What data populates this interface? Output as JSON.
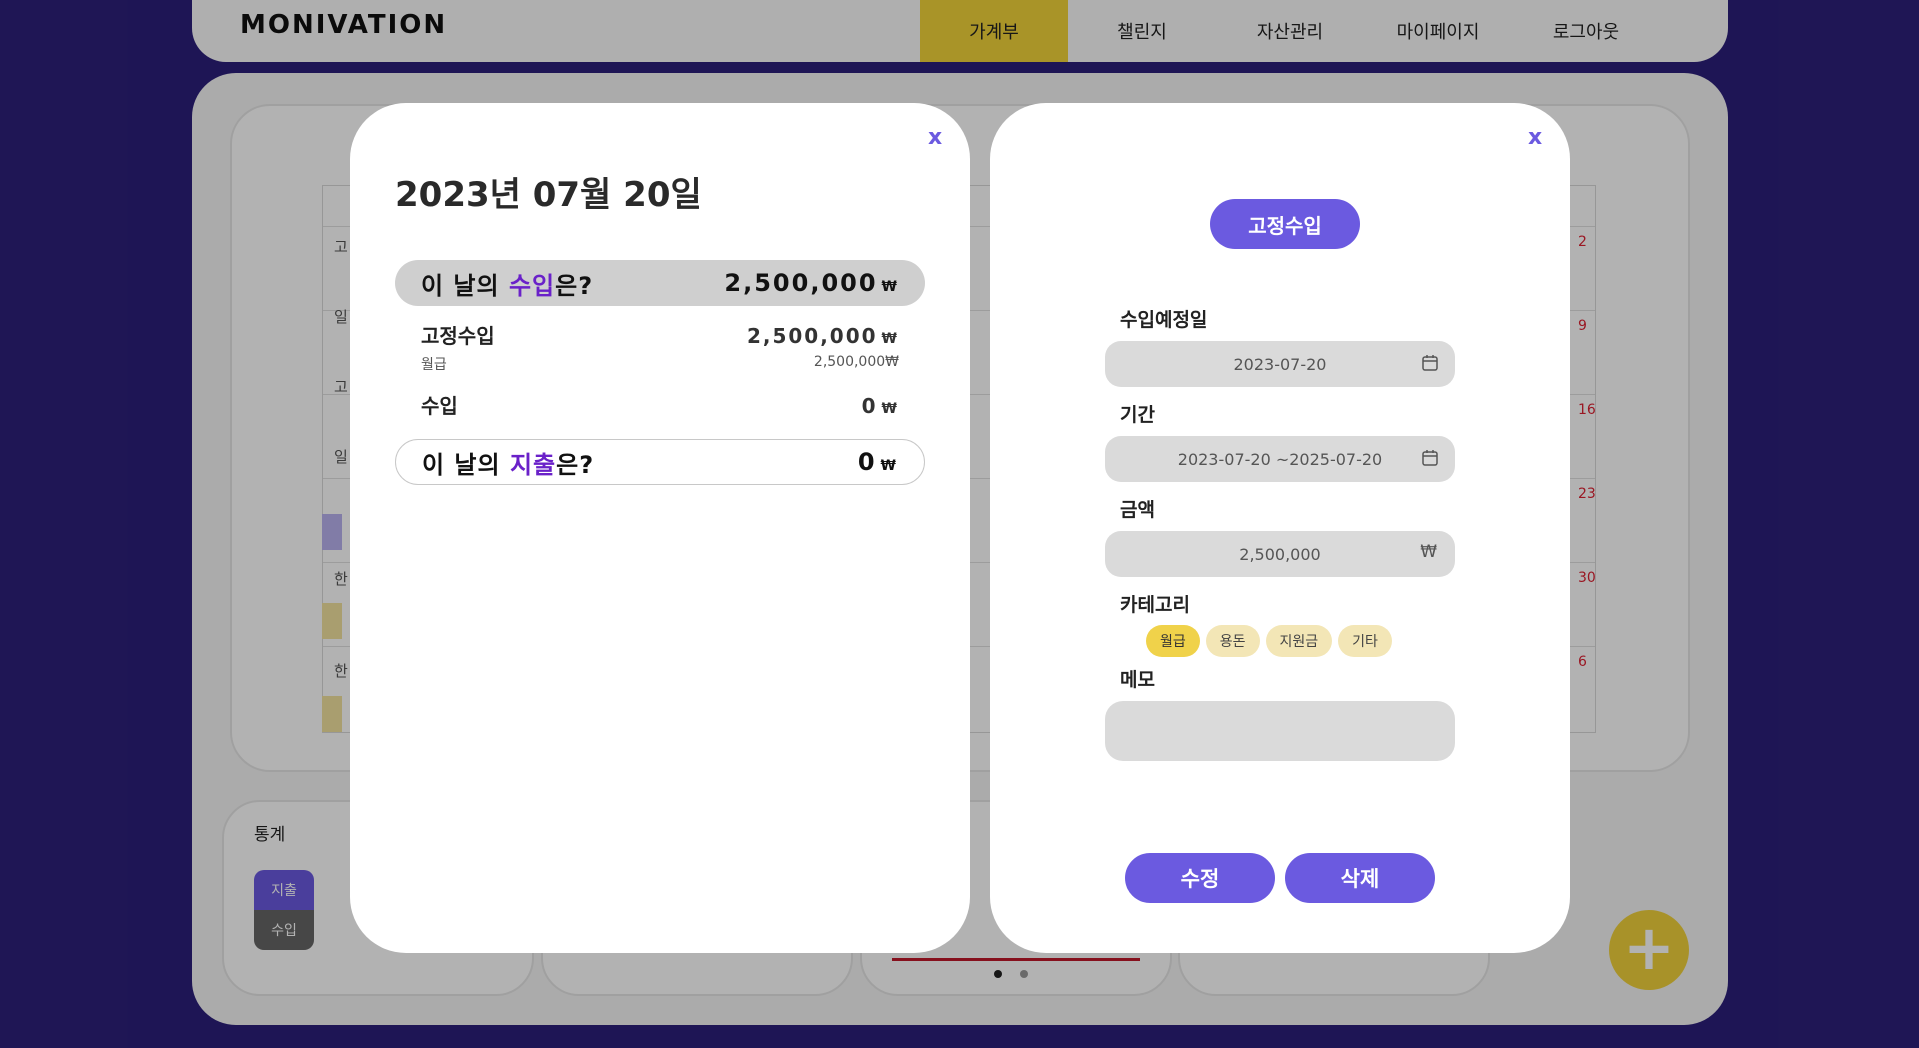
{
  "app": {
    "logo": "MONIVATION"
  },
  "nav": [
    "가계부",
    "챌린지",
    "자산관리",
    "마이페이지",
    "로그아웃"
  ],
  "background": {
    "stats_title": "통계",
    "stats_toggle": [
      "지출",
      "수입"
    ],
    "calendar_side": [
      "고",
      "일",
      "고",
      "일"
    ],
    "calendar_side2": [
      "한",
      "한"
    ],
    "red_dates": [
      "2",
      "9",
      "16",
      "23",
      "30",
      "6"
    ]
  },
  "day_modal": {
    "close": "x",
    "date": "2023년 07월 20일",
    "income_q_pre": "이 날의 ",
    "income_q_hl": "수입",
    "income_q_post": "은?",
    "income_total": "2,500,000",
    "won": "₩",
    "fixed_income_label": "고정수입",
    "fixed_income_amount": "2,500,000",
    "fixed_income_item_label": "월급",
    "fixed_income_item_amount": "2,500,000₩",
    "income_label": "수입",
    "income_amount": "0",
    "expense_q_pre": "이 날의 ",
    "expense_q_hl": "지출",
    "expense_q_post": "은?",
    "expense_total": "0"
  },
  "edit_modal": {
    "close": "x",
    "type": "고정수입",
    "scheduled_label": "수입예정일",
    "scheduled_value": "2023-07-20",
    "period_label": "기간",
    "period_value": "2023-07-20 ~2025-07-20",
    "amount_label": "금액",
    "amount_value": "2,500,000",
    "amount_unit": "₩",
    "category_label": "카테고리",
    "categories": [
      "월급",
      "용돈",
      "지원금",
      "기타"
    ],
    "selected_category": "월급",
    "memo_label": "메모",
    "memo_value": "",
    "edit_button": "수정",
    "delete_button": "삭제"
  },
  "colors": {
    "accent": "#6b5ae0",
    "highlight": "#6a21c9",
    "yellow": "#f3d43a",
    "background": "#2c1f7a"
  }
}
